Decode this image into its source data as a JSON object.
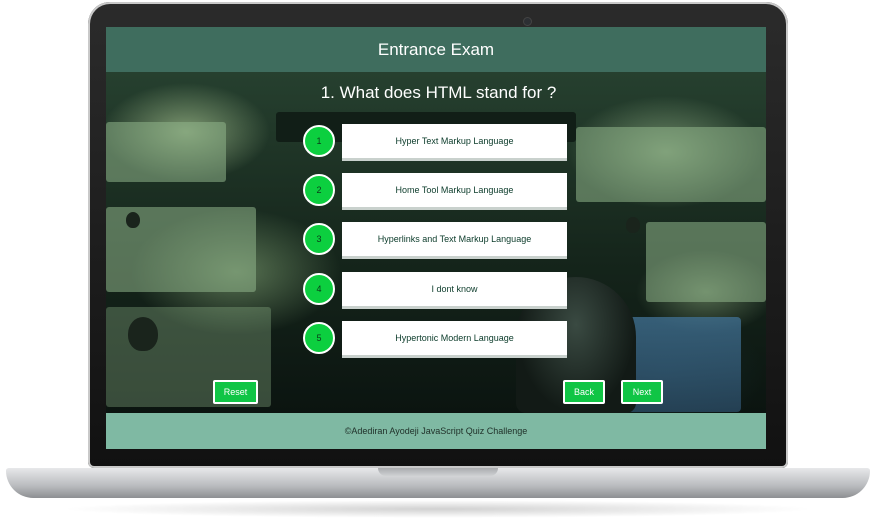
{
  "header": {
    "title": "Entrance Exam"
  },
  "question": {
    "text": "1. What does HTML stand for ?"
  },
  "options": [
    {
      "number": "1",
      "label": "Hyper Text Markup Language"
    },
    {
      "number": "2",
      "label": "Home Tool Markup Language"
    },
    {
      "number": "3",
      "label": "Hyperlinks and Text Markup Language"
    },
    {
      "number": "4",
      "label": "I dont know"
    },
    {
      "number": "5",
      "label": "Hypertonic Modern Language"
    }
  ],
  "buttons": {
    "reset": "Reset",
    "back": "Back",
    "next": "Next"
  },
  "footer": {
    "text": "©Adediran Ayodeji JavaScript Quiz Challenge"
  },
  "colors": {
    "header_bg": "#3f6d5e",
    "accent_green": "#10c545",
    "footer_bg": "#7fb9a3"
  }
}
